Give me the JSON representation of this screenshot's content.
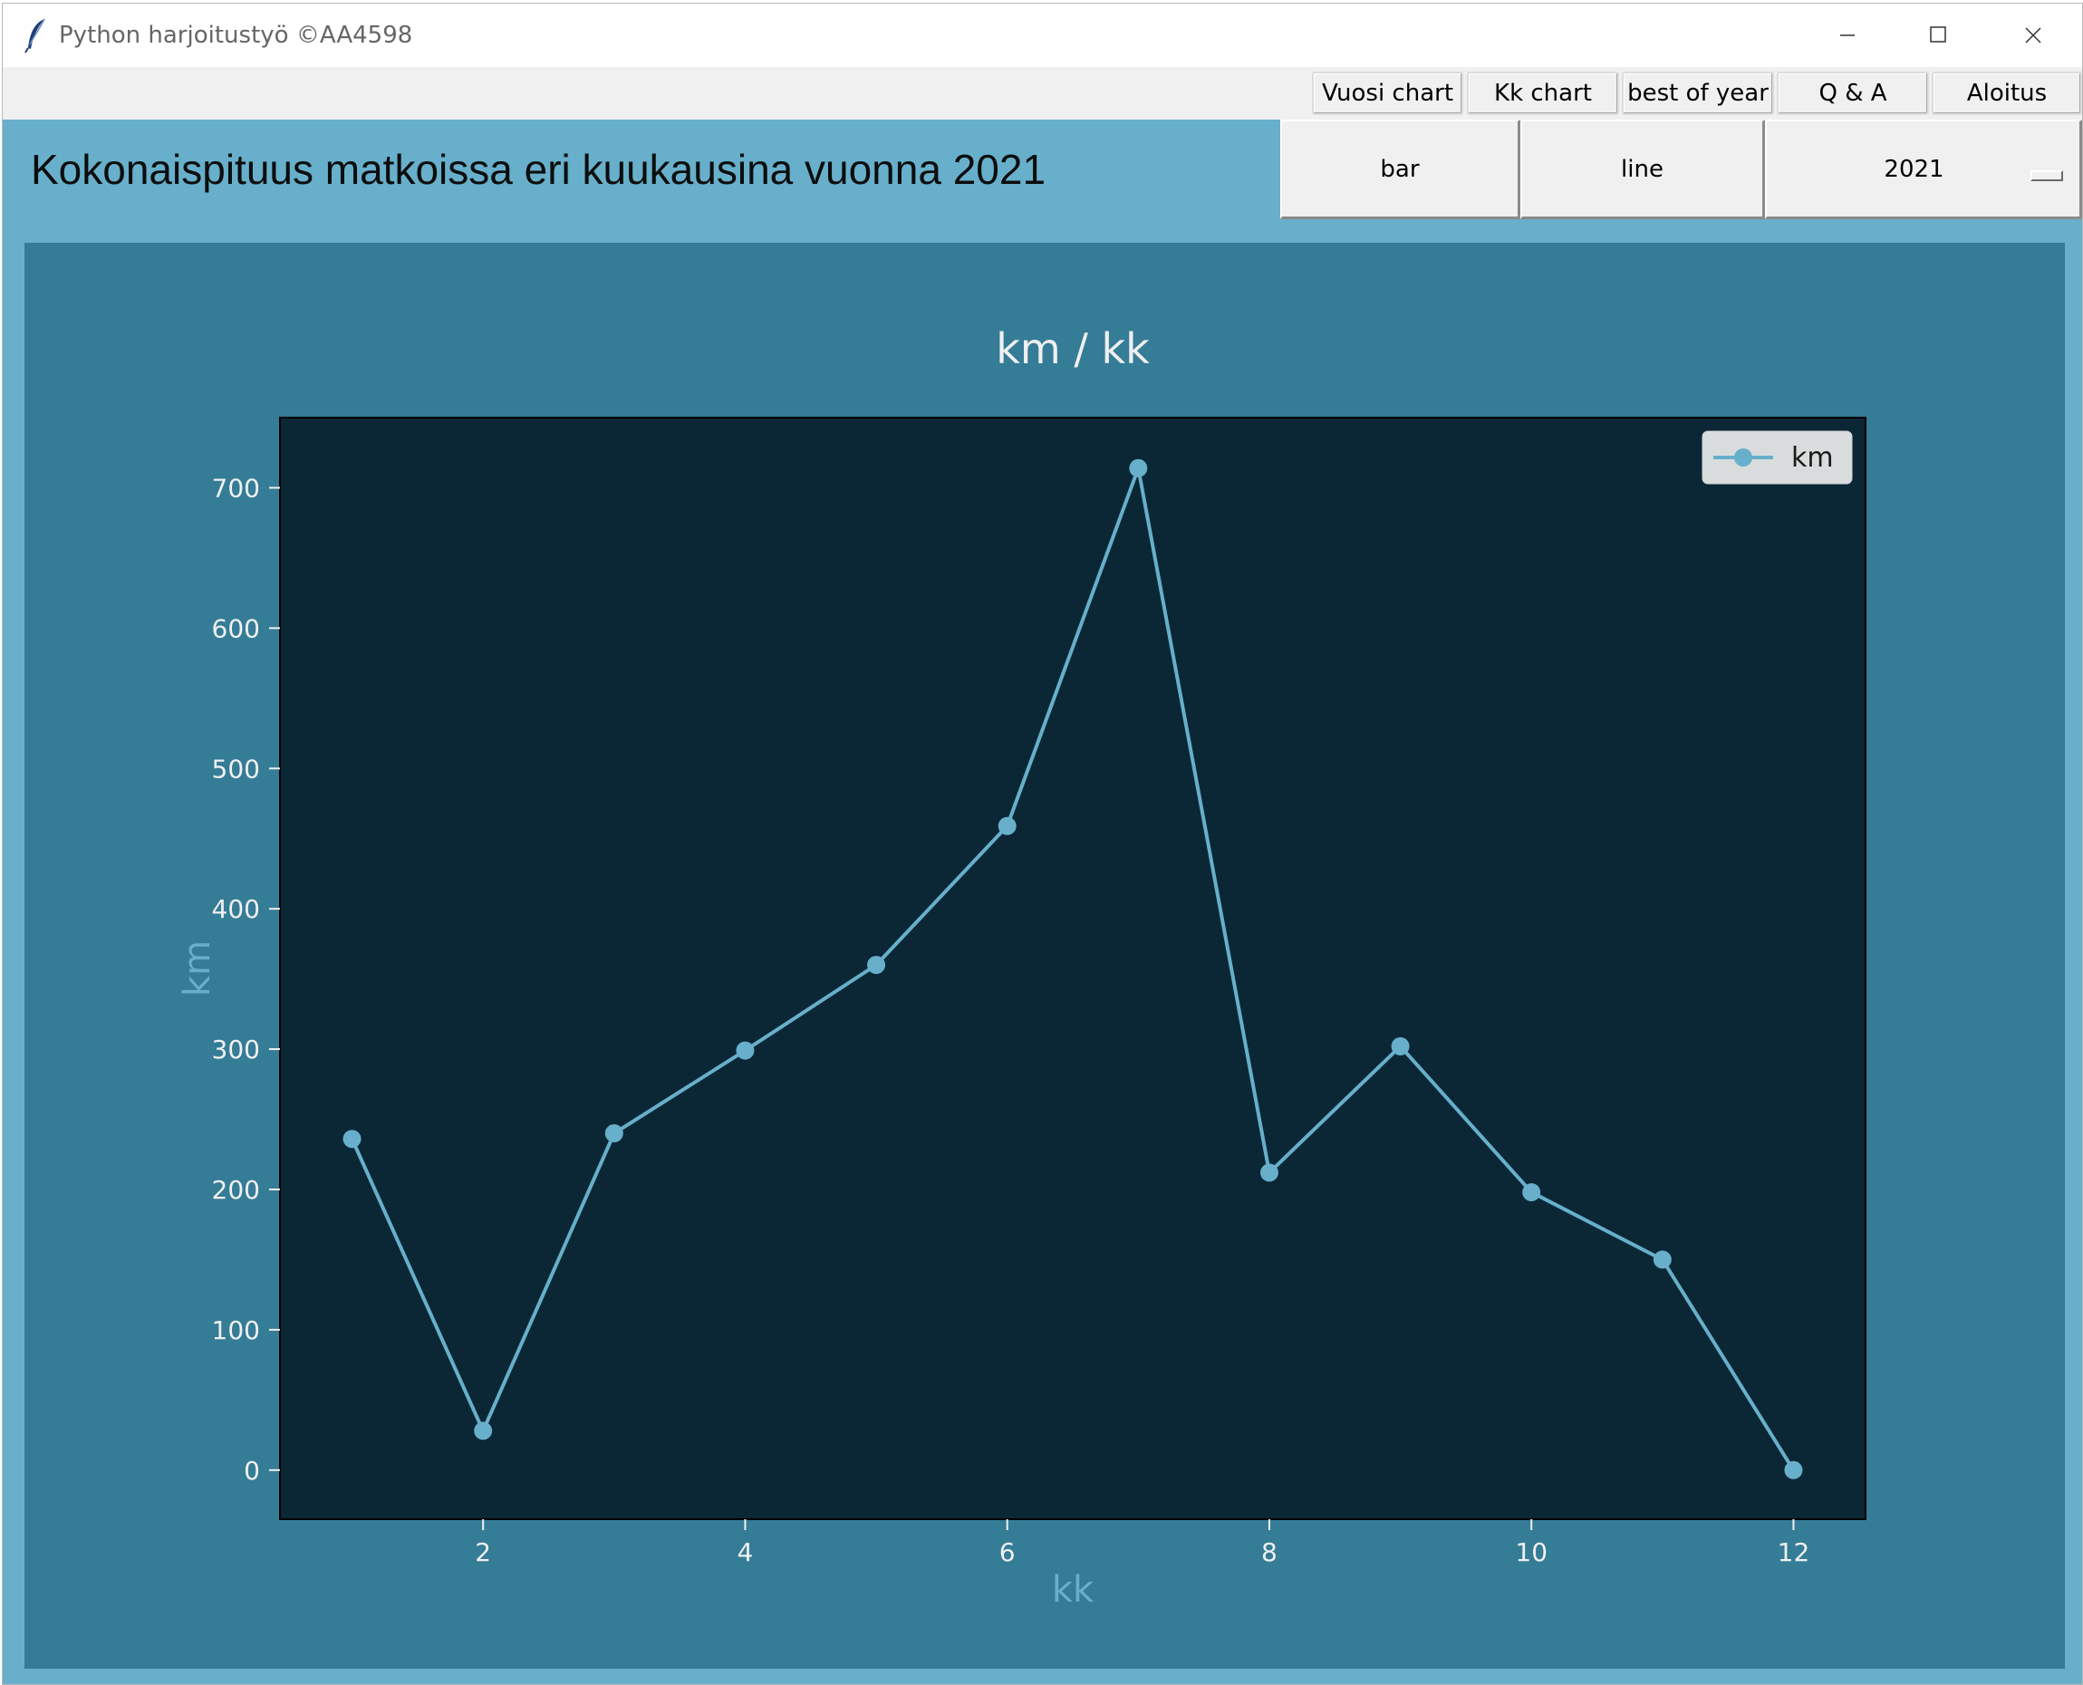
{
  "window": {
    "title": "Python harjoitustyö ©AA4598",
    "icon": "feather-icon"
  },
  "nav": {
    "buttons": [
      {
        "label": "Vuosi chart"
      },
      {
        "label": "Kk chart"
      },
      {
        "label": "best of year"
      },
      {
        "label": "Q & A"
      },
      {
        "label": "Aloitus"
      }
    ]
  },
  "header": {
    "title": "Kokonaispituus matkoissa eri kuukausina vuonna 2021"
  },
  "controls": {
    "bar_label": "bar",
    "line_label": "line",
    "year_value": "2021"
  },
  "colors": {
    "line": "#67afcb",
    "axes_bg": "#0b2735",
    "figure_bg": "#357c97",
    "window_bg": "#67afcb",
    "tick_text": "#f0f0f0",
    "axis_label": "#67afcb"
  },
  "chart_data": {
    "type": "line",
    "title": "km / kk",
    "xlabel": "kk",
    "ylabel": "km",
    "x": [
      1,
      2,
      3,
      4,
      5,
      6,
      7,
      8,
      9,
      10,
      11,
      12
    ],
    "series": [
      {
        "name": "km",
        "values": [
          236,
          28,
          240,
          299,
          360,
          459,
          714,
          212,
          302,
          198,
          150,
          0
        ]
      }
    ],
    "xlim": [
      0.45,
      12.55
    ],
    "ylim": [
      -35,
      750
    ],
    "xticks": [
      2,
      4,
      6,
      8,
      10,
      12
    ],
    "yticks": [
      0,
      100,
      200,
      300,
      400,
      500,
      600,
      700
    ],
    "grid": false,
    "legend": "top-right",
    "markers": true
  }
}
